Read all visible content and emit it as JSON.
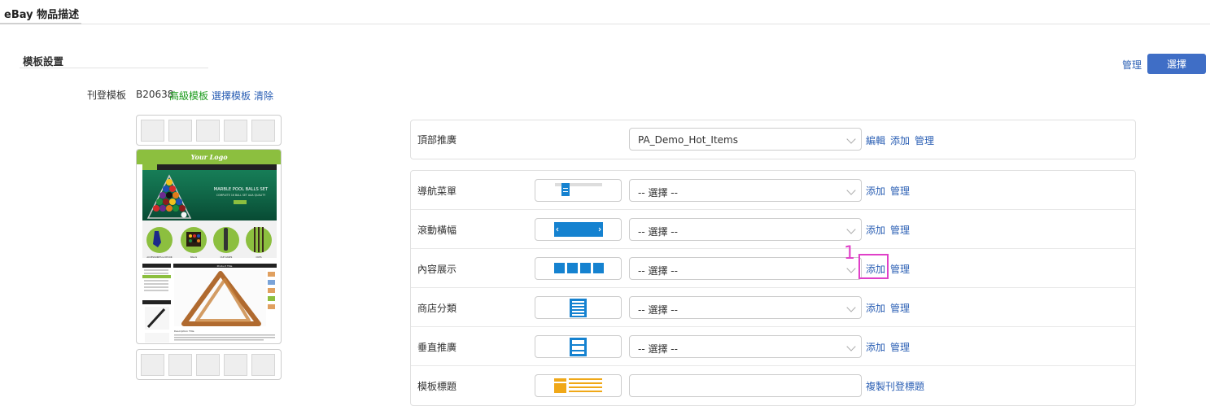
{
  "header": {
    "title": "eBay 物品描述"
  },
  "section": {
    "title": "模板設置"
  },
  "toolbar": {
    "manage": "管理",
    "select": "選擇"
  },
  "template": {
    "label": "刊登模板",
    "code": "B20638",
    "advanced": "高級模板",
    "choose": "選擇模板",
    "clear": "清除"
  },
  "preview": {
    "logo": "Your Logo",
    "banner_title": "MARBLE POOL BALLS SET",
    "banner_sub": "COMPLETE 16 BALL SET AAA QUALITY",
    "categories": [
      "ACCESSORIES & DECOR",
      "BALLS",
      "CUE CASES",
      "CUES"
    ],
    "product_title": "Product Title",
    "description_title": "Description Title"
  },
  "top_promo": {
    "label": "頂部推廣",
    "value": "PA_Demo_Hot_Items",
    "edit": "編輯",
    "add": "添加",
    "manage": "管理"
  },
  "rows": [
    {
      "label": "導航菜單",
      "value": "-- 選擇 --",
      "add": "添加",
      "manage": "管理"
    },
    {
      "label": "滾動橫幅",
      "value": "-- 選擇 --",
      "add": "添加",
      "manage": "管理"
    },
    {
      "label": "內容展示",
      "value": "-- 選擇 --",
      "add": "添加",
      "manage": "管理"
    },
    {
      "label": "商店分類",
      "value": "-- 選擇 --",
      "add": "添加",
      "manage": "管理"
    },
    {
      "label": "垂直推廣",
      "value": "-- 選擇 --",
      "add": "添加",
      "manage": "管理"
    },
    {
      "label": "模板標題",
      "value": "",
      "copy": "複製刊登標題"
    }
  ],
  "annotation": {
    "marker": "1"
  },
  "colors": {
    "accent": "#3f6ec6",
    "link": "#2b5fb4",
    "green": "#1a9b1a",
    "highlight": "#e040c8",
    "icon_blue": "#1582d0",
    "icon_orange": "#f0a818"
  }
}
